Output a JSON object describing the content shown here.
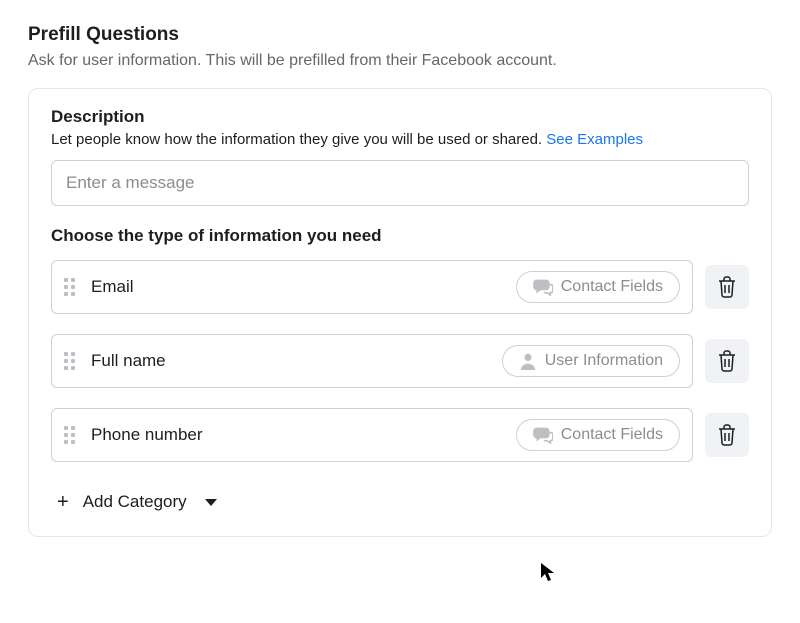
{
  "header": {
    "title": "Prefill Questions",
    "subtitle": "Ask for user information. This will be prefilled from their Facebook account."
  },
  "description": {
    "heading": "Description",
    "help_text": "Let people know how the information they give you will be used or shared. ",
    "examples_link": "See Examples",
    "input_placeholder": "Enter a message",
    "input_value": ""
  },
  "choose": {
    "heading": "Choose the type of information you need"
  },
  "fields": [
    {
      "label": "Email",
      "category_label": "Contact Fields",
      "category_icon": "chat"
    },
    {
      "label": "Full name",
      "category_label": "User Information",
      "category_icon": "user"
    },
    {
      "label": "Phone number",
      "category_label": "Contact Fields",
      "category_icon": "chat"
    }
  ],
  "add": {
    "label": "Add Category"
  }
}
